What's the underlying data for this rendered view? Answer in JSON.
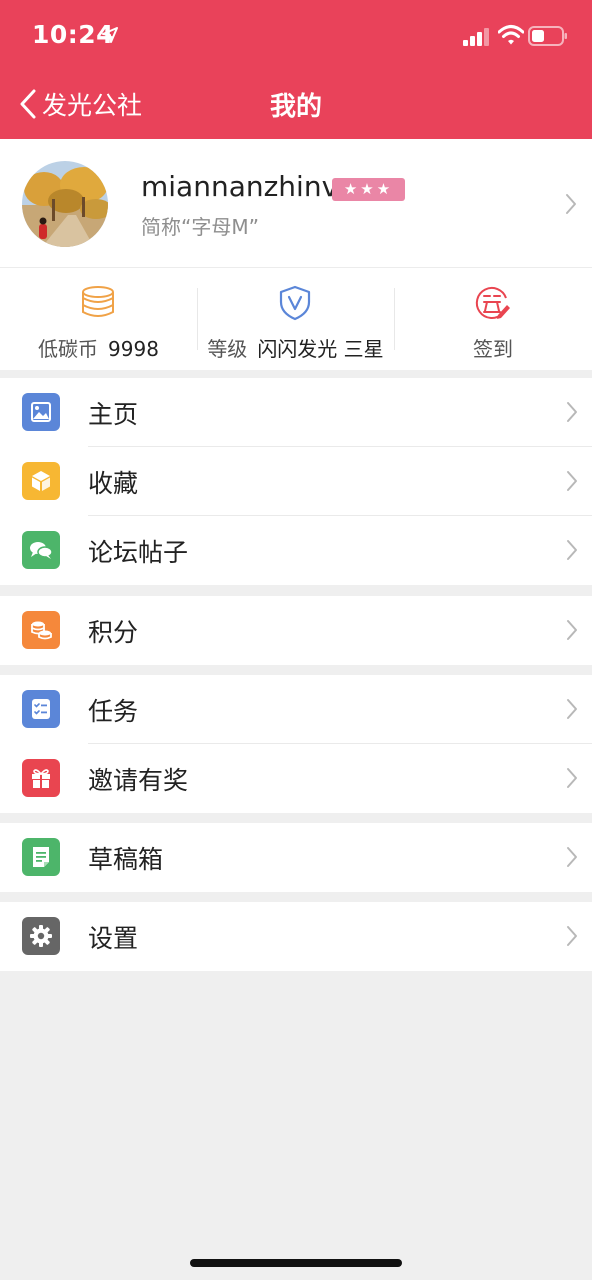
{
  "status_bar": {
    "time": "10:24"
  },
  "nav": {
    "back_label": "发光公社",
    "title": "我的"
  },
  "profile": {
    "username": "miannanzhinv",
    "stars": "★★★",
    "nickname": "简称“字母M”"
  },
  "stats": [
    {
      "label": "低碳币",
      "value": "9998",
      "icon": "coins-stack-icon"
    },
    {
      "label": "等级",
      "value": "闪闪发光 三星",
      "icon": "shield-v-icon"
    },
    {
      "label": "签到",
      "value": "",
      "icon": "sign-in-icon"
    }
  ],
  "menu": {
    "home": "主页",
    "favorites": "收藏",
    "forum_posts": "论坛帖子",
    "points": "积分",
    "tasks": "任务",
    "invite": "邀请有奖",
    "drafts": "草稿箱",
    "settings": "设置"
  },
  "colors": {
    "header": "#e9425a",
    "home": "#5b86d8",
    "favorites": "#f7b733",
    "forum": "#4db56a",
    "points": "#f5883b",
    "tasks": "#5b86d8",
    "invite": "#e94550",
    "drafts": "#4db56a",
    "settings": "#666666"
  }
}
